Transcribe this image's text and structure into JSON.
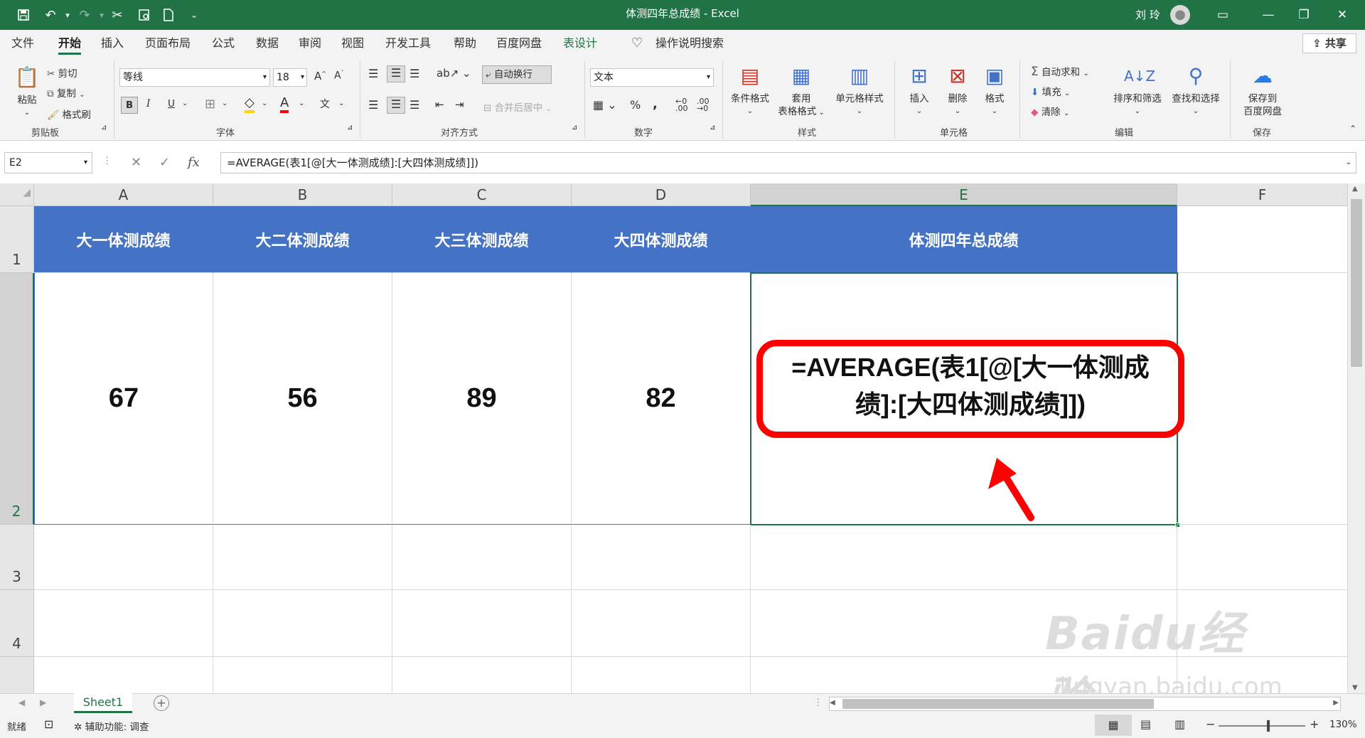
{
  "window": {
    "title": "体测四年总成绩 - Excel",
    "user_name": "刘 玲",
    "qat_icons": [
      "save-icon",
      "undo-icon",
      "redo-icon",
      "cut-icon",
      "print-preview-icon",
      "new-file-icon",
      "customize-qat-icon"
    ]
  },
  "menu": {
    "tabs": [
      "文件",
      "开始",
      "插入",
      "页面布局",
      "公式",
      "数据",
      "审阅",
      "视图",
      "开发工具",
      "帮助",
      "百度网盘",
      "表设计"
    ],
    "tell_me": "操作说明搜索",
    "share": "共享"
  },
  "ribbon": {
    "clipboard": {
      "paste": "粘贴",
      "cut": "剪切",
      "copy": "复制",
      "format_painter": "格式刷",
      "label": "剪贴板"
    },
    "font": {
      "name": "等线",
      "size": "18",
      "label": "字体",
      "bold": "B",
      "italic": "I",
      "underline": "U"
    },
    "alignment": {
      "wrap_text": "自动换行",
      "merge_center": "合并后居中",
      "label": "对齐方式"
    },
    "number": {
      "format": "文本",
      "label": "数字",
      "percent": "%",
      "comma": ","
    },
    "styles": {
      "conditional": "条件格式",
      "format_table_1": "套用",
      "format_table_2": "表格格式",
      "cell_styles": "单元格样式",
      "label": "样式"
    },
    "cells": {
      "insert": "插入",
      "delete": "删除",
      "format": "格式",
      "label": "单元格"
    },
    "editing": {
      "autosum": "自动求和",
      "fill": "填充",
      "clear": "清除",
      "sort_filter": "排序和筛选",
      "find_select": "查找和选择",
      "label": "编辑"
    },
    "save": {
      "save_to_1": "保存到",
      "save_to_2": "百度网盘",
      "label": "保存"
    }
  },
  "formula_bar": {
    "name_box": "E2",
    "formula": "=AVERAGE(表1[@[大一体测成绩]:[大四体测成绩]])"
  },
  "grid": {
    "columns": [
      "A",
      "B",
      "C",
      "D",
      "E",
      "F"
    ],
    "rows": [
      "1",
      "2",
      "3",
      "4"
    ],
    "headers": [
      "大一体测成绩",
      "大二体测成绩",
      "大三体测成绩",
      "大四体测成绩",
      "体测四年总成绩"
    ],
    "values": [
      "67",
      "56",
      "89",
      "82"
    ]
  },
  "callout": {
    "line1": "=AVERAGE(表1[@[大一体测成",
    "line2": "绩]:[大四体测成绩]])",
    "color": "#ff0000"
  },
  "sheets": {
    "tabs": [
      "Sheet1"
    ]
  },
  "status": {
    "ready": "就绪",
    "accessibility": "辅助功能: 调查",
    "zoom": "130%"
  },
  "watermark": {
    "brand": "Baidu经验",
    "url": "jingyan.baidu.com"
  },
  "colors": {
    "excel_green": "#217346",
    "table_header": "#4472c4",
    "arrow": "#ff0000"
  }
}
